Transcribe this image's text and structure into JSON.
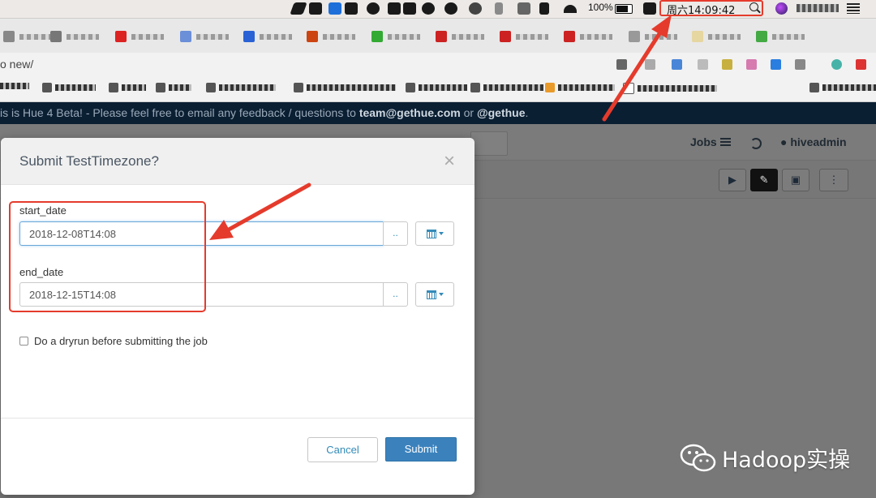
{
  "menubar": {
    "battery": "100%",
    "clock": "周六14:09:42"
  },
  "browser": {
    "url_fragment": "o new/"
  },
  "banner": {
    "prefix": "is is Hue 4 Beta! - Please feel free to email any feedback / questions to ",
    "email": "team@gethue.com",
    "middle": " or ",
    "handle": "@gethue",
    "suffix": "."
  },
  "hue": {
    "jobs_label": "Jobs",
    "user": "hiveadmin"
  },
  "modal": {
    "title": "Submit TestTimezone?",
    "close_glyph": "×",
    "fields": [
      {
        "label": "start_date",
        "value": "2018-12-08T14:08",
        "dots": ".."
      },
      {
        "label": "end_date",
        "value": "2018-12-15T14:08",
        "dots": ".."
      }
    ],
    "dryrun_label": "Do a dryrun before submitting the job",
    "cancel_label": "Cancel",
    "submit_label": "Submit"
  },
  "watermark": {
    "text": "Hadoop实操"
  },
  "colors": {
    "annotation_red": "#e53b2c",
    "primary_blue": "#3b82bd",
    "banner_navy": "#0b1f33"
  }
}
